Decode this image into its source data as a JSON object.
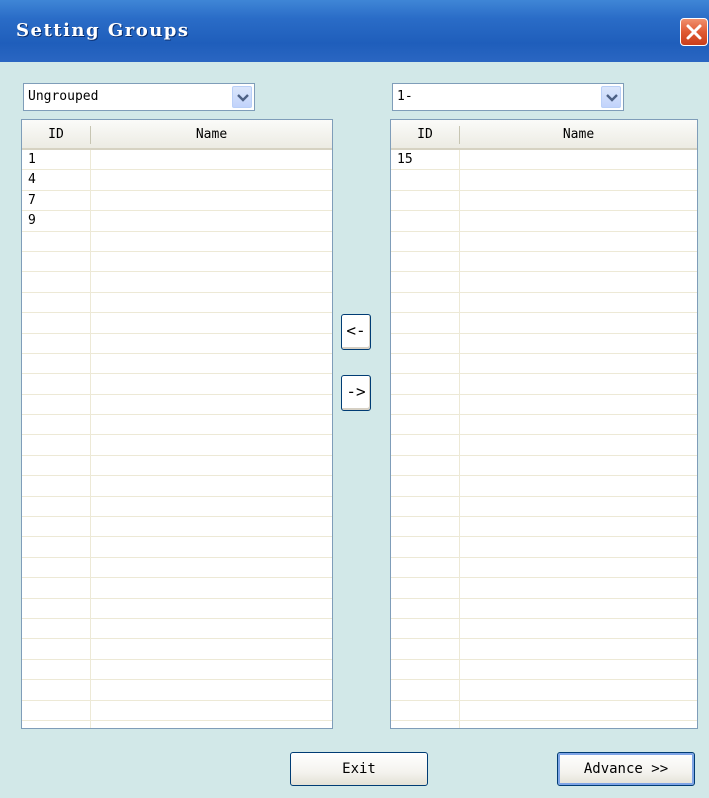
{
  "window": {
    "title": "Setting Groups",
    "close_icon": "close-icon"
  },
  "left": {
    "combo_value": "Ungrouped",
    "columns": [
      "ID",
      "Name"
    ],
    "rows": [
      {
        "id": "1",
        "name": ""
      },
      {
        "id": "4",
        "name": ""
      },
      {
        "id": "7",
        "name": ""
      },
      {
        "id": "9",
        "name": ""
      }
    ]
  },
  "right": {
    "combo_value": "1-",
    "columns": [
      "ID",
      "Name"
    ],
    "rows": [
      {
        "id": "15",
        "name": ""
      }
    ]
  },
  "move": {
    "to_left": "<-",
    "to_right": "->"
  },
  "footer": {
    "exit_label": "Exit",
    "advance_label": "Advance >>"
  },
  "colors": {
    "titlebar": "#2a6cc7",
    "background": "#d2e8e8",
    "close": "#e05a33"
  }
}
